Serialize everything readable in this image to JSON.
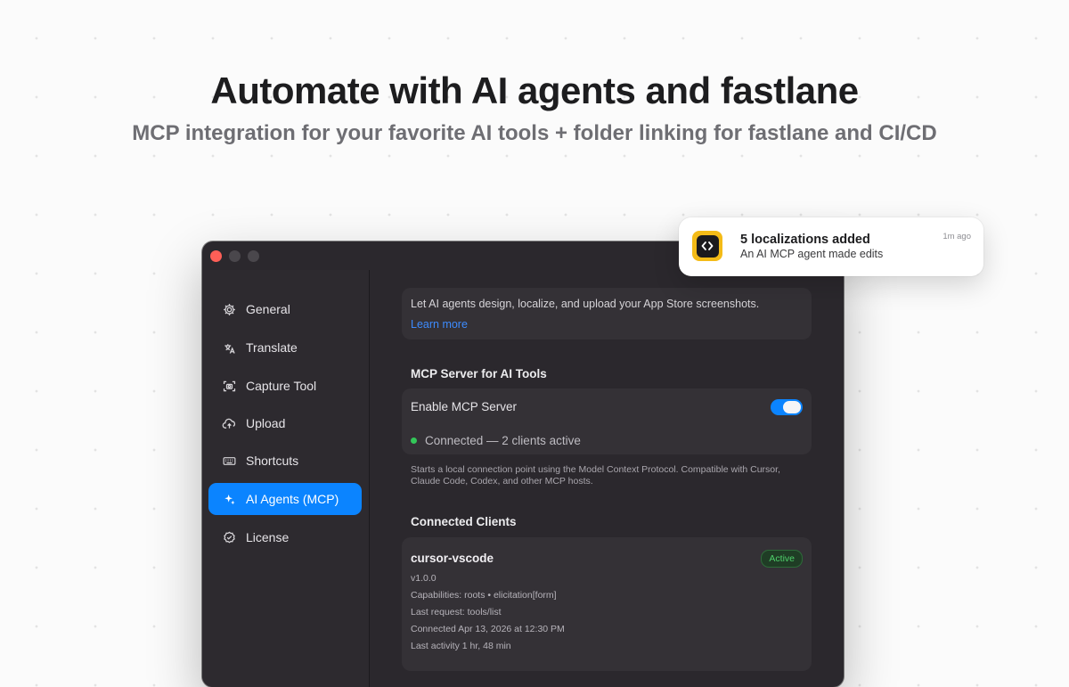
{
  "hero": {
    "title": "Automate with AI agents and fastlane",
    "subtitle": "MCP integration for your favorite AI tools + folder linking for fastlane and CI/CD"
  },
  "sidebar": {
    "items": [
      {
        "label": "General",
        "icon": "gear-icon"
      },
      {
        "label": "Translate",
        "icon": "translate-icon"
      },
      {
        "label": "Capture Tool",
        "icon": "capture-icon"
      },
      {
        "label": "Upload",
        "icon": "cloud-upload-icon"
      },
      {
        "label": "Shortcuts",
        "icon": "keyboard-icon"
      },
      {
        "label": "AI Agents (MCP)",
        "icon": "sparkle-icon"
      },
      {
        "label": "License",
        "icon": "checkmark-seal-icon"
      }
    ],
    "active_item": "AI Agents (MCP)"
  },
  "main": {
    "intro": {
      "text": "Let AI agents design, localize, and upload your App Store screenshots.",
      "link": "Learn more"
    },
    "mcp_section": {
      "title": "MCP Server for AI Tools",
      "toggle_label": "Enable MCP Server",
      "toggle_on": true,
      "status": "Connected — 2 clients active",
      "description": "Starts a local connection point using the Model Context Protocol. Compatible with Cursor, Claude Code, Codex, and other MCP hosts."
    },
    "clients_section": {
      "title": "Connected Clients",
      "clients": [
        {
          "name": "cursor-vscode",
          "badge": "Active",
          "version": "v1.0.0",
          "capabilities": "Capabilities: roots • elicitation[form]",
          "last_request": "Last request: tools/list",
          "connected": "Connected Apr 13, 2026 at 12:30 PM",
          "last_activity": "Last activity 1 hr, 48 min"
        }
      ]
    }
  },
  "notification": {
    "title": "5 localizations added",
    "body": "An AI MCP agent made edits",
    "time": "1m ago",
    "icon": "code-brackets-icon"
  },
  "colors": {
    "accent": "#0b84ff",
    "status_green": "#33c759",
    "window_bg": "#2b282d",
    "notification_icon_bg": "#f4bb17"
  }
}
